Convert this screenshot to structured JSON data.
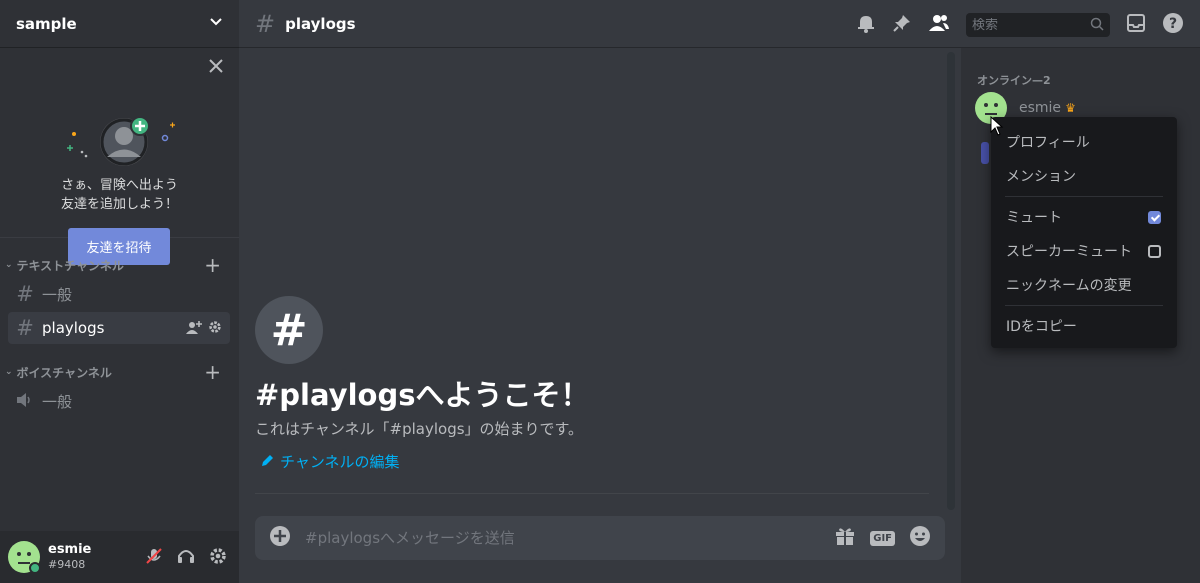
{
  "server": {
    "name": "sample"
  },
  "promo": {
    "line1": "さぁ、冒険へ出よう",
    "line2": "友達を追加しよう！",
    "invite_label": "友達を招待"
  },
  "categories": {
    "text": "テキストチャンネル",
    "voice": "ボイスチャンネル"
  },
  "channels": {
    "general": "一般",
    "playlogs": "playlogs",
    "voice_general": "一般"
  },
  "user": {
    "name": "esmie",
    "tag": "#9408"
  },
  "header": {
    "channel": "playlogs",
    "search_placeholder": "検索"
  },
  "welcome": {
    "title": "#playlogsへようこそ！",
    "description": "これはチャンネル「#playlogs」の始まりです。",
    "edit_label": "チャンネルの編集"
  },
  "composer": {
    "placeholder": "#playlogsへメッセージを送信",
    "gif_label": "GIF"
  },
  "members": {
    "online_label": "オンライン—2",
    "first_member": "esmie"
  },
  "context_menu": {
    "profile": "プロフィール",
    "mention": "メンション",
    "mute": "ミュート",
    "mute_checked": true,
    "speaker_mute": "スピーカーミュート",
    "speaker_mute_checked": false,
    "nickname": "ニックネームの変更",
    "copy_id": "IDをコピー"
  },
  "colors": {
    "accent": "#7289da",
    "link": "#00b0f4",
    "avatar_green": "#a3e28f",
    "online": "#43b581"
  }
}
